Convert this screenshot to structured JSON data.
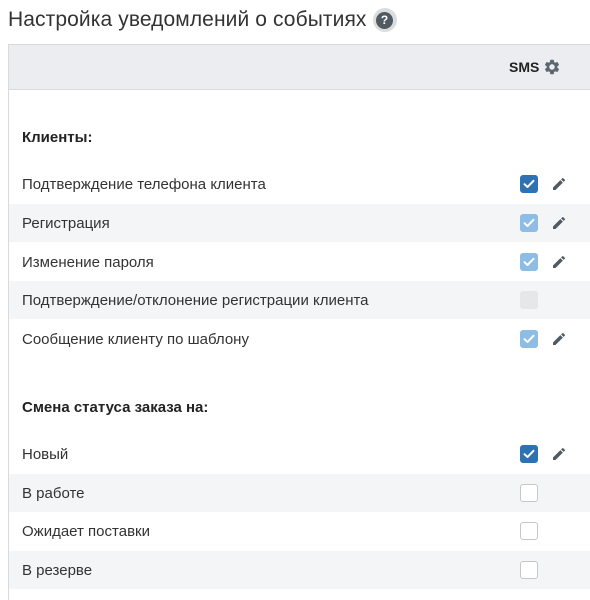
{
  "header": {
    "title": "Настройка уведомлений о событиях",
    "help_icon": "?"
  },
  "table": {
    "channel_label": "SMS",
    "channel_icon": "gear-icon"
  },
  "colors": {
    "checked": "#2d73b4",
    "checked_inherited": "#8dbce4",
    "header_bg": "#ebedf0",
    "stripe_bg": "#f4f5f7"
  },
  "sections": [
    {
      "title": "Клиенты:",
      "rows": [
        {
          "label": "Подтверждение телефона клиента",
          "state": "checked",
          "editable": true
        },
        {
          "label": "Регистрация",
          "state": "checked-light",
          "editable": true
        },
        {
          "label": "Изменение пароля",
          "state": "checked-light",
          "editable": true
        },
        {
          "label": "Подтверждение/отклонение регистрации клиента",
          "state": "disabled",
          "editable": false
        },
        {
          "label": "Сообщение клиенту по шаблону",
          "state": "checked-light",
          "editable": true
        }
      ]
    },
    {
      "title": "Смена статуса заказа на:",
      "rows": [
        {
          "label": "Новый",
          "state": "checked",
          "editable": true
        },
        {
          "label": "В работе",
          "state": "unchecked",
          "editable": false
        },
        {
          "label": "Ожидает поставки",
          "state": "unchecked",
          "editable": false
        },
        {
          "label": "В резерве",
          "state": "unchecked",
          "editable": false
        }
      ]
    }
  ]
}
